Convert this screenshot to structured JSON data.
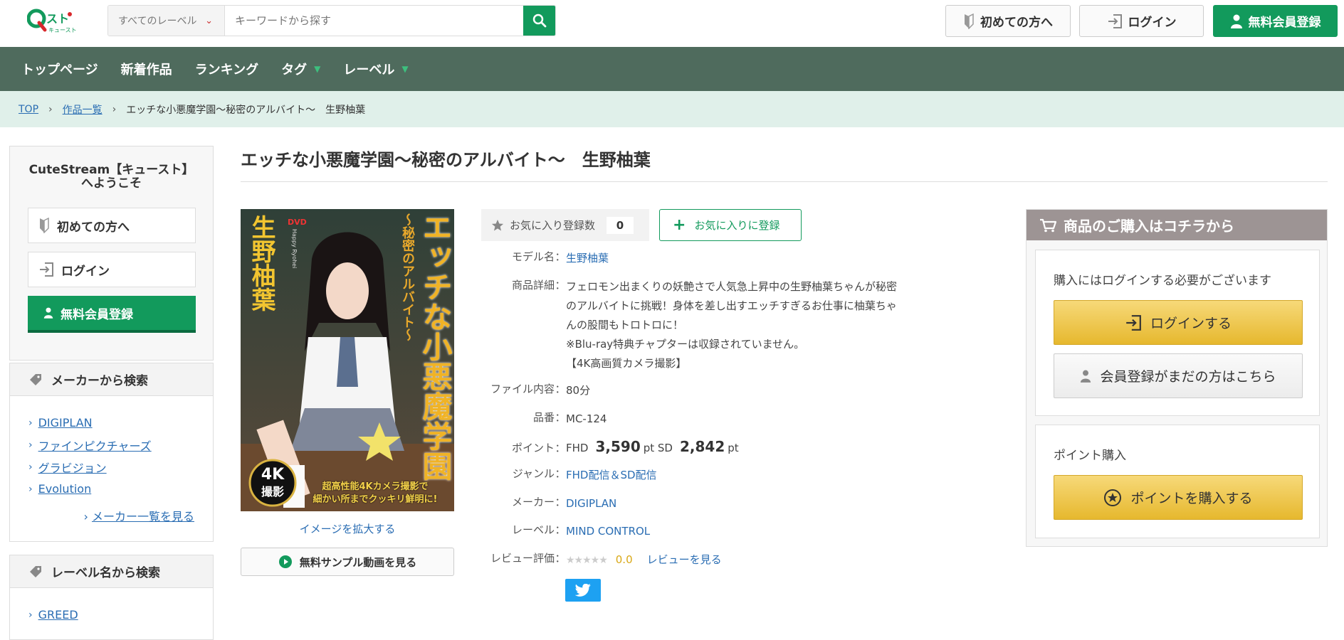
{
  "header": {
    "logo_text": "Qストキュースト",
    "search": {
      "category": "すべてのレーベル",
      "placeholder": "キーワードから探す"
    },
    "beginner_label": "初めての方へ",
    "login_label": "ログイン",
    "register_label": "無料会員登録"
  },
  "nav": {
    "items": [
      {
        "label": "トップページ"
      },
      {
        "label": "新着作品"
      },
      {
        "label": "ランキング"
      },
      {
        "label": "タグ"
      },
      {
        "label": "レーベル"
      }
    ]
  },
  "breadcrumb": {
    "top": "TOP",
    "list": "作品一覧",
    "current": "エッチな小悪魔学園～秘密のアルバイト～　生野柚葉"
  },
  "sidebar": {
    "welcome_line1": "CuteStream【キュースト】",
    "welcome_line2": "へようこそ",
    "beginner_label": "初めての方へ",
    "login_label": "ログイン",
    "register_label": "無料会員登録",
    "maker_title": "メーカーから検索",
    "makers": [
      "DIGIPLAN",
      "ファインピクチャーズ",
      "グラビジョン",
      "Evolution"
    ],
    "maker_more": "メーカー一覧を見る",
    "label_title": "レーベル名から検索",
    "labels": [
      "GREED"
    ]
  },
  "product": {
    "title": "エッチな小悪魔学園～秘密のアルバイト～　生野柚葉",
    "cover": {
      "title_text": "エッチな小悪魔学園",
      "subtitle_text": "～秘密のアルバイト～",
      "model_text": "生野柚葉",
      "badge_4k": "4K",
      "badge_shoot": "撮影",
      "caption1": "超高性能4Kカメラ撮影で",
      "caption2": "細かい所までクッキリ鮮明に!",
      "dvd": "DVD",
      "series": "Happy Ryohei"
    },
    "enlarge_label": "イメージを拡大する",
    "sample_label": "無料サンプル動画を見る",
    "fav_count_label": "お気に入り登録数",
    "fav_count": "0",
    "fav_button_label": "お気に入りに登録",
    "labels": {
      "model": "モデル名",
      "detail": "商品詳細",
      "file": "ファイル内容",
      "code": "品番",
      "point": "ポイント",
      "genre": "ジャンル",
      "maker": "メーカー",
      "label": "レーベル",
      "review": "レビュー評価"
    },
    "separator": "：",
    "model_name": "生野柚葉",
    "detail_lines": [
      "フェロモン出まくりの妖艶さで人気急上昇中の生野柚葉ちゃんが秘密",
      "のアルバイトに挑戦！身体を差し出すエッチすぎるお仕事に柚葉ちゃ",
      "んの股間もトロトロに！",
      "※Blu-ray特典チャプターは収録されていません。",
      "【4K高画質カメラ撮影】"
    ],
    "file_content": "80分",
    "code": "MC-124",
    "points": {
      "fhd_label": "FHD",
      "fhd_value": "3,590",
      "sd_label": "pt SD",
      "sd_value": "2,842",
      "unit": "pt"
    },
    "genre": "FHD配信＆SD配信",
    "maker": "DIGIPLAN",
    "label": "MIND CONTROL",
    "review_stars": "★★★★★",
    "review_score": "0.0",
    "review_link": "レビューを見る"
  },
  "purchase": {
    "header": "商品のご購入はコチラから",
    "login_notice": "購入にはログインする必要がございます",
    "login_button": "ログインする",
    "register_button": "会員登録がまだの方はこちら",
    "point_title": "ポイント購入",
    "point_button": "ポイントを購入する"
  },
  "colors": {
    "green": "#129a5c",
    "nav_bg": "#4f6b5d",
    "crumb_bg": "#e0f0ea",
    "link": "#2a6db3",
    "gold": "#e6b82e"
  }
}
